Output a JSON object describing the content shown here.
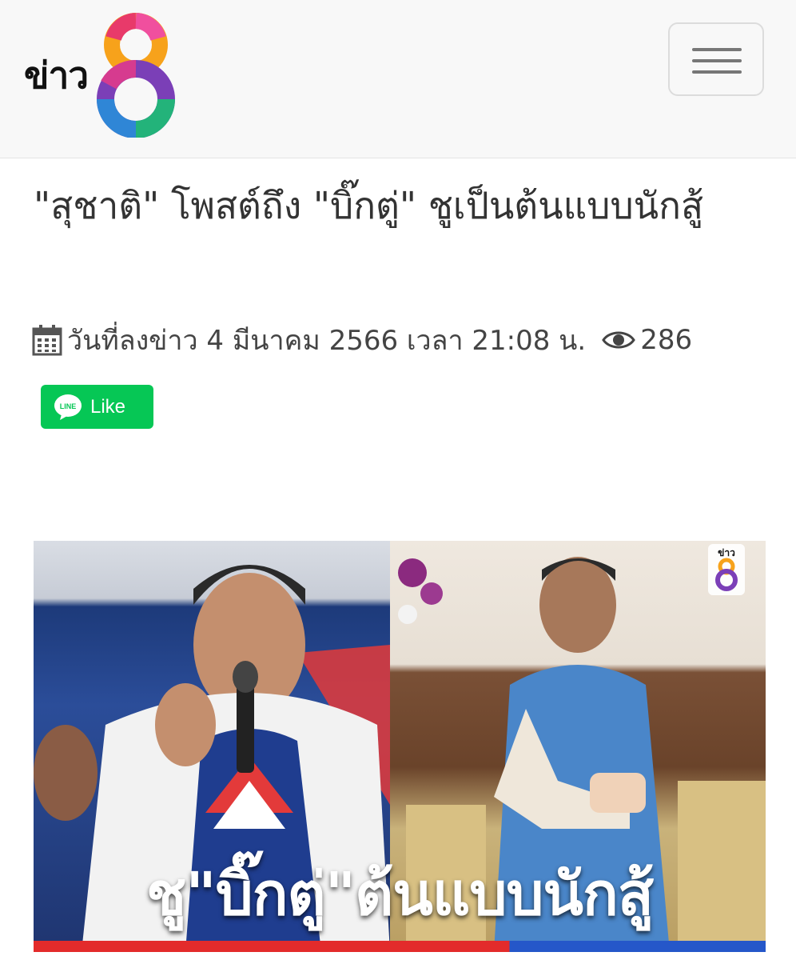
{
  "header": {
    "logo_text": "ข่าว",
    "logo_icon": "channel8-logo",
    "menu_icon": "hamburger-menu-icon"
  },
  "article": {
    "title": "\"สุชาติ\" โพสต์ถึง \"บิ๊กตู่\" ชูเป็นต้นแบบนักสู้",
    "date_icon": "calendar-icon",
    "date_text": "วันที่ลงข่าว 4 มีนาคม 2566 เวลา 21:08 น.",
    "views_icon": "eye-icon",
    "views": "286"
  },
  "share": {
    "line_label": "Like",
    "line_icon_text": "LINE",
    "color": "#06c755"
  },
  "photo": {
    "caption": "ชู\"บิ๊กตู่\"ต้นแบบนักสู้",
    "watermark_text": "ข่าว"
  }
}
